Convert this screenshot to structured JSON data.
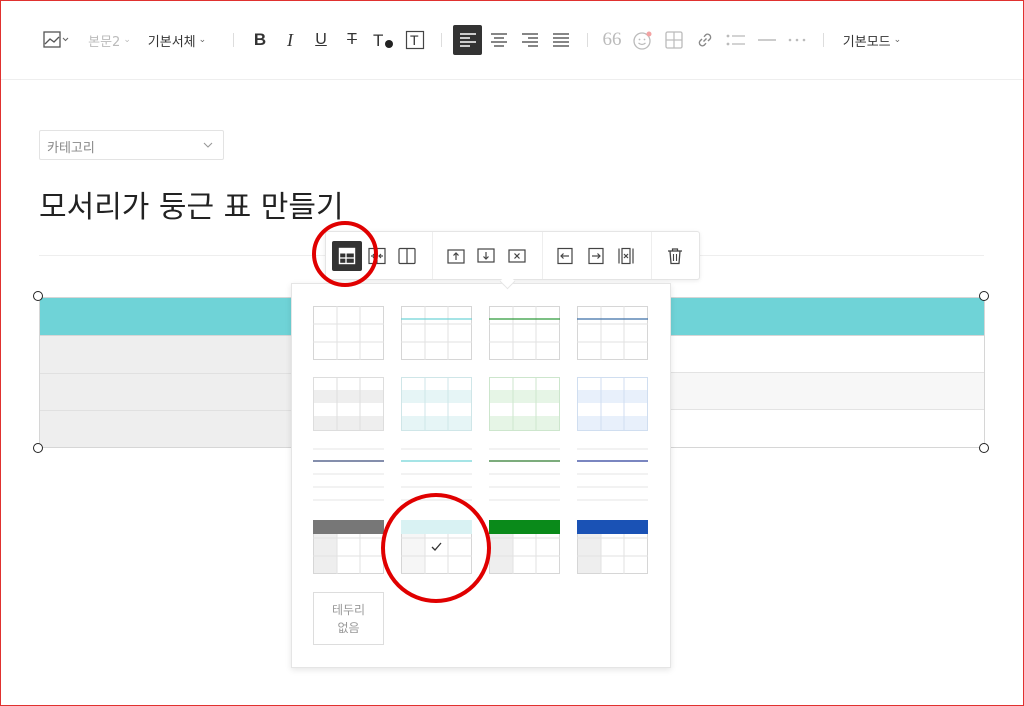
{
  "toolbar": {
    "paragraph_style": "본문2",
    "font_family": "기본서체",
    "mode": "기본모드"
  },
  "editor": {
    "category_placeholder": "카테고리",
    "title": "모서리가 둥근 표 만들기"
  },
  "table_style_panel": {
    "no_border_label_line1": "테두리",
    "no_border_label_line2": "없음",
    "selected_style_index": 13
  },
  "colors": {
    "table_header": "#6fd3d7",
    "highlight_circle": "#e00000",
    "active_button": "#333333"
  },
  "icons": {
    "table_style": "table-style-icon",
    "delete": "trash-icon"
  }
}
